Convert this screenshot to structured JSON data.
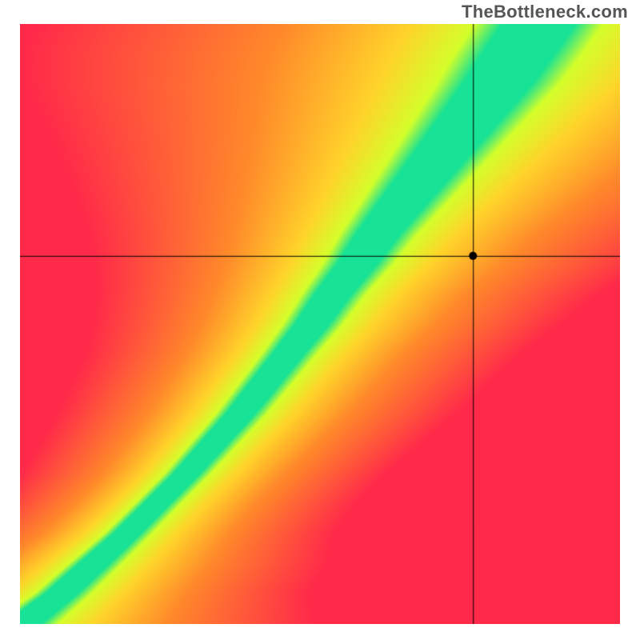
{
  "watermark": "TheBottleneck.com",
  "colors": {
    "red": "#ff2a4a",
    "orange": "#ff8a2a",
    "yellow": "#ffd52a",
    "lime": "#d5ff2a",
    "green": "#17e296",
    "cross": "#000000",
    "dot": "#000000"
  },
  "chart_data": {
    "type": "heatmap",
    "title": "",
    "xlabel": "",
    "ylabel": "",
    "xlim": [
      0,
      1
    ],
    "ylim": [
      0,
      1
    ],
    "crosshair": {
      "x": 0.756,
      "y": 0.613
    },
    "marker": {
      "x": 0.756,
      "y": 0.613
    },
    "curve_description": "Ideal curve is slightly S-shaped: passes through (0,0), bows above the y=x diagonal through the middle, and reaches roughly (0.85,1.0) at the top. Vertical green band width is ~0.07 near the bottom, narrows to ~0.05 in the middle, and widens to ~0.12 near the top.",
    "curve_samples": [
      {
        "y": 0.0,
        "x": 0.0,
        "half_width": 0.035
      },
      {
        "y": 0.05,
        "x": 0.065,
        "half_width": 0.03
      },
      {
        "y": 0.1,
        "x": 0.12,
        "half_width": 0.028
      },
      {
        "y": 0.15,
        "x": 0.175,
        "half_width": 0.025
      },
      {
        "y": 0.2,
        "x": 0.225,
        "half_width": 0.024
      },
      {
        "y": 0.25,
        "x": 0.275,
        "half_width": 0.024
      },
      {
        "y": 0.3,
        "x": 0.32,
        "half_width": 0.025
      },
      {
        "y": 0.35,
        "x": 0.365,
        "half_width": 0.026
      },
      {
        "y": 0.4,
        "x": 0.405,
        "half_width": 0.027
      },
      {
        "y": 0.45,
        "x": 0.445,
        "half_width": 0.028
      },
      {
        "y": 0.5,
        "x": 0.485,
        "half_width": 0.03
      },
      {
        "y": 0.55,
        "x": 0.52,
        "half_width": 0.032
      },
      {
        "y": 0.6,
        "x": 0.56,
        "half_width": 0.035
      },
      {
        "y": 0.65,
        "x": 0.595,
        "half_width": 0.038
      },
      {
        "y": 0.7,
        "x": 0.635,
        "half_width": 0.042
      },
      {
        "y": 0.75,
        "x": 0.675,
        "half_width": 0.046
      },
      {
        "y": 0.8,
        "x": 0.715,
        "half_width": 0.05
      },
      {
        "y": 0.85,
        "x": 0.755,
        "half_width": 0.054
      },
      {
        "y": 0.9,
        "x": 0.795,
        "half_width": 0.058
      },
      {
        "y": 0.95,
        "x": 0.83,
        "half_width": 0.06
      },
      {
        "y": 1.0,
        "x": 0.865,
        "half_width": 0.06
      }
    ],
    "band_transitions_comment": "Distance thresholds (in normalized-x units from ideal curve center) at which color shifts from green→lime→yellow→orange→red. Beyond red threshold color saturates.",
    "band_transitions": {
      "green_end": 1.0,
      "lime_end": 1.8,
      "yellow_end": 3.5,
      "orange_end": 7.0
    },
    "asymmetry_comment": "Left side (x below ideal) falls off ~1.3x faster than right side in lower half; becomes more symmetric toward top."
  }
}
